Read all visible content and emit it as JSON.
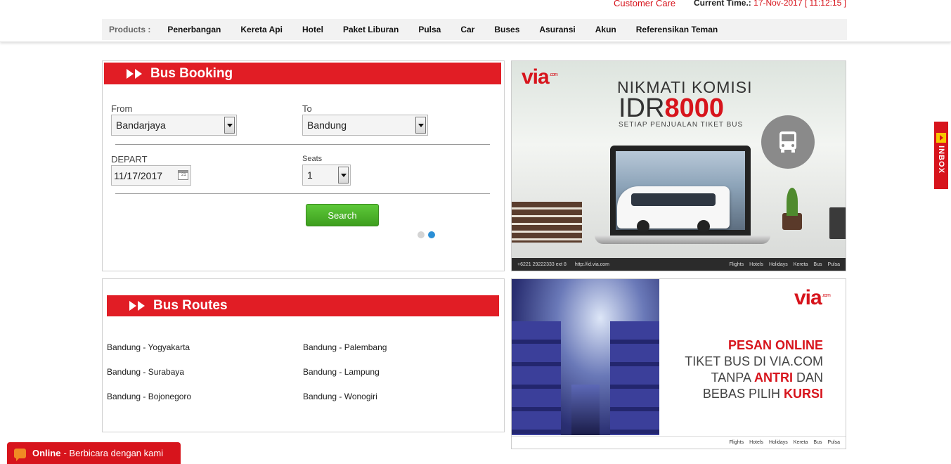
{
  "header": {
    "customer_care": "Customer Care",
    "current_time_label": "Current Time.:",
    "current_time_value": "17-Nov-2017 [ 11:12:15 ]"
  },
  "nav": {
    "label": "Products :",
    "items": [
      "Penerbangan",
      "Kereta Api",
      "Hotel",
      "Paket Liburan",
      "Pulsa",
      "Car",
      "Buses",
      "Asuransi",
      "Akun",
      "Referensikan Teman"
    ]
  },
  "booking": {
    "title": "Bus Booking",
    "from_label": "From",
    "from_value": "Bandarjaya",
    "to_label": "To",
    "to_value": "Bandung",
    "depart_label": "DEPART",
    "depart_value": "11/17/2017",
    "seats_label": "Seats",
    "seats_value": "1",
    "search_label": "Search"
  },
  "routes": {
    "title": "Bus Routes",
    "items": [
      "Bandung - Yogyakarta",
      "Bandung - Palembang",
      "Bandung - Surabaya",
      "Bandung - Lampung",
      "Bandung - Bojonegoro",
      "Bandung - Wonogiri"
    ]
  },
  "banner1": {
    "logo": "via",
    "logo_suffix": ".com",
    "line1": "NIKMATI KOMISI",
    "line2a": "IDR",
    "line2b": "8000",
    "line3": "SETIAP PENJUALAN TIKET BUS",
    "phone": "+6221 29222333 ext 8",
    "url": "http://id.via.com",
    "services": [
      "Flights",
      "Hotels",
      "Holidays",
      "Kereta",
      "Bus",
      "Pulsa"
    ]
  },
  "banner2": {
    "logo": "via",
    "logo_suffix": ".com",
    "line1": "PESAN ONLINE",
    "line2": "TIKET BUS DI VIA.COM",
    "line3a": "TANPA ",
    "line3b": "ANTRI",
    "line3c": " DAN",
    "line4a": "BEBAS PILIH ",
    "line4b": "KURSI",
    "services": [
      "Flights",
      "Hotels",
      "Holidays",
      "Kereta",
      "Bus",
      "Pulsa"
    ]
  },
  "inbox": {
    "label": "INBOX"
  },
  "chat": {
    "status": "Online",
    "text": "- Berbicara dengan kami"
  },
  "colors": {
    "brand_red": "#e11d25",
    "search_green": "#4cae2a",
    "dot_active": "#2a8fd6"
  },
  "icons": [
    "calendar-icon",
    "chevron-icon",
    "bus-icon",
    "chat-bubble-icon",
    "inbox-arrow-icon"
  ]
}
